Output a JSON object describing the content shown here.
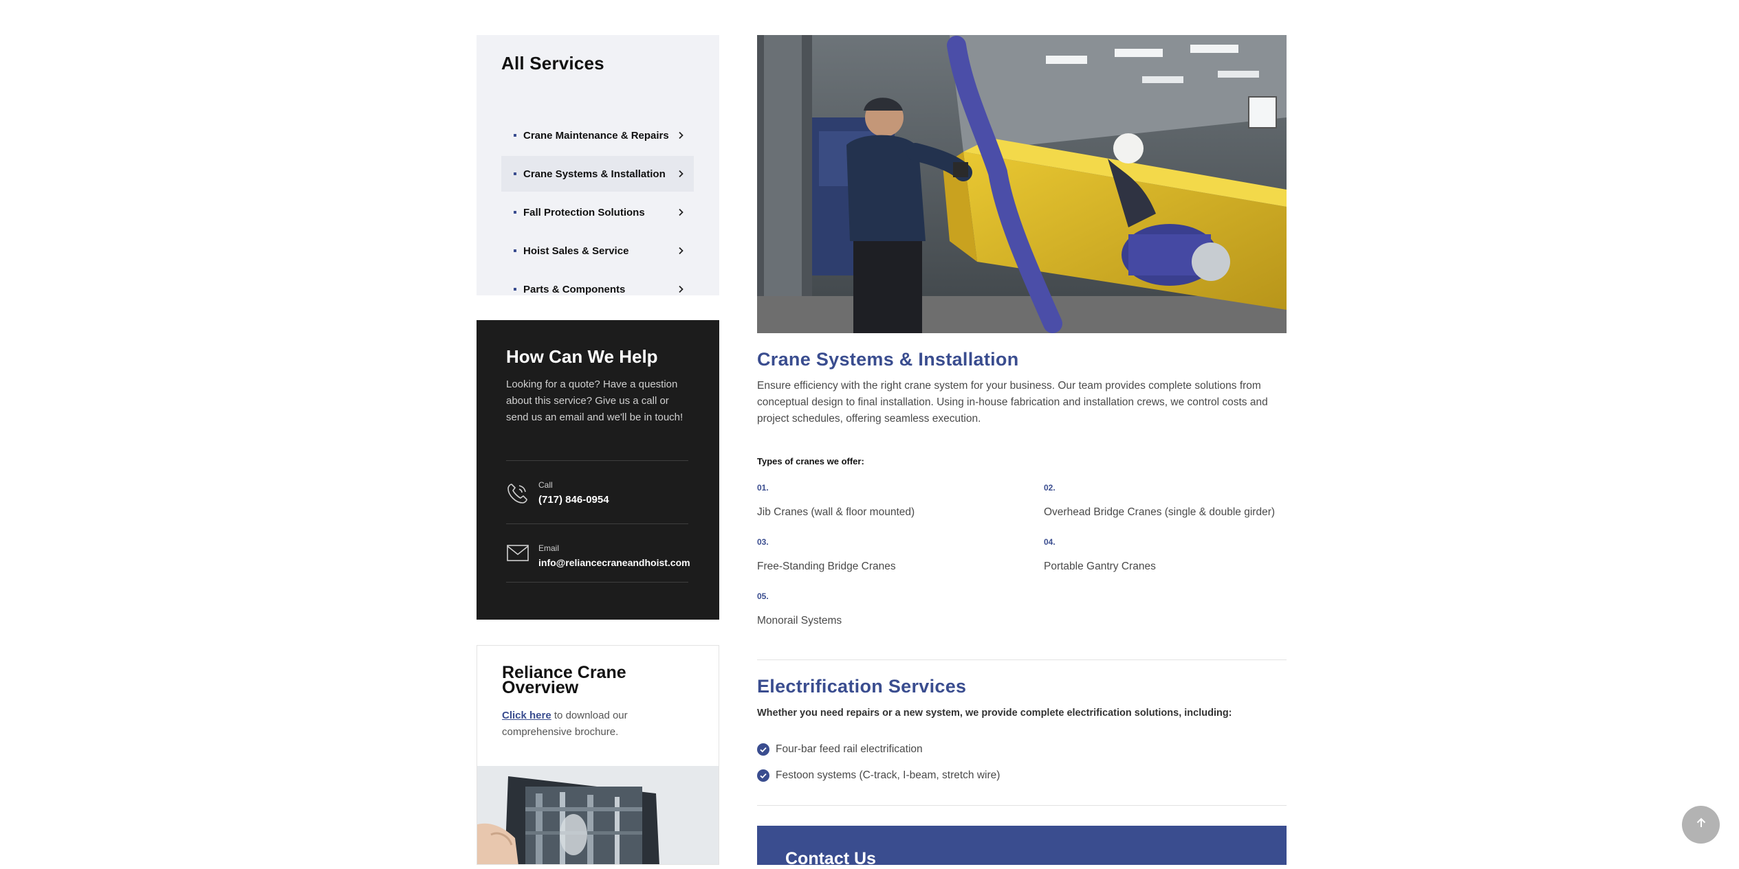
{
  "sidebar": {
    "title": "All Services",
    "items": [
      {
        "label": "Crane Maintenance & Repairs"
      },
      {
        "label": "Crane Systems & Installation"
      },
      {
        "label": "Fall Protection Solutions"
      },
      {
        "label": "Hoist Sales & Service"
      },
      {
        "label": "Parts & Components"
      }
    ],
    "active_index": 1
  },
  "help": {
    "title": "How Can We Help",
    "text": "Looking for a quote? Have a question about this service? Give us a call or send us an email and we'll be in touch!",
    "call_label": "Call",
    "call_value": "(717) 846-0954",
    "email_label": "Email",
    "email_value": "info@reliancecraneandhoist.com"
  },
  "overview": {
    "title": "Reliance Crane Overview",
    "link_text": "Click here",
    "text_after": " to download our comprehensive brochure."
  },
  "main": {
    "title": "Crane Systems & Installation",
    "description": "Ensure efficiency with the right crane system for your business. Our team provides complete solutions from conceptual design to final installation. Using in-house fabrication and installation crews, we control costs and project schedules, offering seamless execution.",
    "types_title": "Types of cranes we offer:",
    "types": [
      {
        "num": "01.",
        "label": "Jib Cranes (wall & floor mounted)"
      },
      {
        "num": "02.",
        "label": "Overhead Bridge Cranes (single & double girder)"
      },
      {
        "num": "03.",
        "label": "Free-Standing Bridge Cranes"
      },
      {
        "num": "04.",
        "label": "Portable Gantry Cranes"
      },
      {
        "num": "05.",
        "label": "Monorail Systems"
      }
    ]
  },
  "electrification": {
    "title": "Electrification Services",
    "lead": "Whether you need repairs or a new system, we provide complete electrification solutions, including:",
    "items": [
      {
        "label": "Four-bar feed rail electrification"
      },
      {
        "label": "Festoon systems (C-track, I-beam, stretch wire)"
      }
    ]
  },
  "contact": {
    "title": "Contact Us"
  },
  "colors": {
    "accent": "#3a4d8f",
    "dark_panel": "#1c1c1c",
    "light_panel": "#f1f2f6"
  }
}
